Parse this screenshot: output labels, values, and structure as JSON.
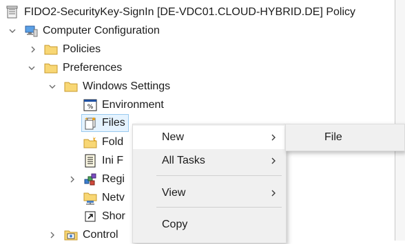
{
  "tree": {
    "root": {
      "label": "FIDO2-SecurityKey-SignIn [DE-VDC01.CLOUD-HYBRID.DE] Policy",
      "icon": "policy-scroll-icon"
    },
    "computer_config": {
      "label": "Computer Configuration",
      "icon": "computer-icon",
      "expanded": true
    },
    "policies": {
      "label": "Policies",
      "icon": "folder-icon",
      "expanded": false
    },
    "preferences": {
      "label": "Preferences",
      "icon": "folder-icon",
      "expanded": true
    },
    "windows_settings": {
      "label": "Windows Settings",
      "icon": "folder-icon",
      "expanded": true
    },
    "environment": {
      "label": "Environment",
      "icon": "environment-icon"
    },
    "files": {
      "label": "Files",
      "icon": "files-icon",
      "selected": true
    },
    "folders": {
      "label": "Fold",
      "icon": "folders-icon"
    },
    "ini_files": {
      "label": "Ini F",
      "icon": "ini-file-icon"
    },
    "registry": {
      "label": "Regi",
      "icon": "registry-icon",
      "expanded": false
    },
    "network_shares": {
      "label": "Netv",
      "icon": "network-shares-icon"
    },
    "shortcuts": {
      "label": "Shor",
      "icon": "shortcut-icon"
    },
    "control_panel": {
      "label": "Control",
      "icon": "control-panel-icon",
      "expanded": false
    }
  },
  "context_menu": {
    "items": [
      {
        "label": "New",
        "submenu": true,
        "hovered": true
      },
      {
        "label": "All Tasks",
        "submenu": true
      },
      {
        "label": "View",
        "submenu": true
      },
      {
        "label": "Copy",
        "submenu": false
      }
    ]
  },
  "submenu": {
    "items": [
      {
        "label": "File"
      }
    ]
  },
  "colors": {
    "menu_bg": "#f0f0f0",
    "menu_hover": "#ffffff",
    "selection_border": "#99c9ef",
    "folder_yellow": "#f8d775"
  }
}
